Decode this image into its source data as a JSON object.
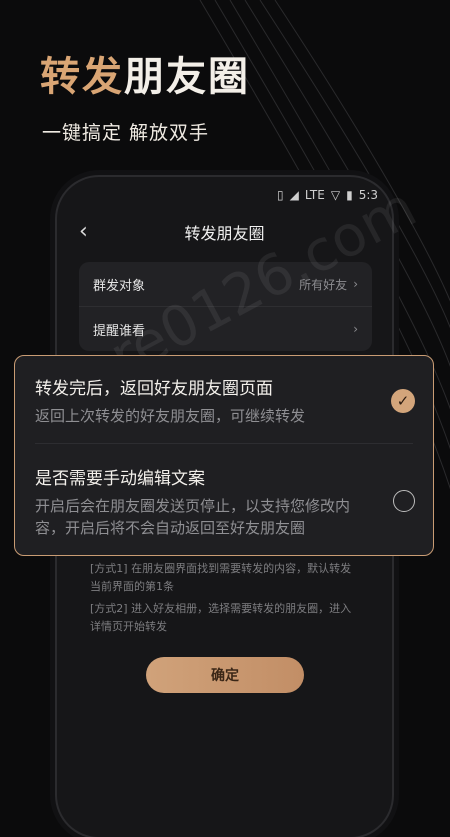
{
  "promo": {
    "headline_accent": "转发",
    "headline_rest": "朋友圈",
    "subline": "一键搞定 解放双手"
  },
  "status_bar": {
    "network": "LTE",
    "time": "5:3"
  },
  "screen": {
    "title": "转发朋友圈",
    "back_icon": "‹",
    "rows": [
      {
        "label": "群发对象",
        "value": "所有好友"
      },
      {
        "label": "提醒谁看",
        "value": ""
      }
    ],
    "hint_lines": [
      "[方式1] 在朋友圈界面找到需要转发的内容，默认转发当前界面的第1条",
      "[方式2] 进入好友相册，选择需要转发的朋友圈，进入详情页开始转发"
    ],
    "confirm_label": "确定"
  },
  "options": [
    {
      "title": "转发完后，返回好友朋友圈页面",
      "desc": "返回上次转发的好友朋友圈，可继续转发",
      "selected": true
    },
    {
      "title": "是否需要手动编辑文案",
      "desc": "开启后会在朋友圈发送页停止，以支持您修改内容，开启后将不会自动返回至好友朋友圈",
      "selected": false
    }
  ],
  "watermark": "re0126.com",
  "colors": {
    "accent": "#d9a574",
    "background": "#0b0b0c"
  }
}
